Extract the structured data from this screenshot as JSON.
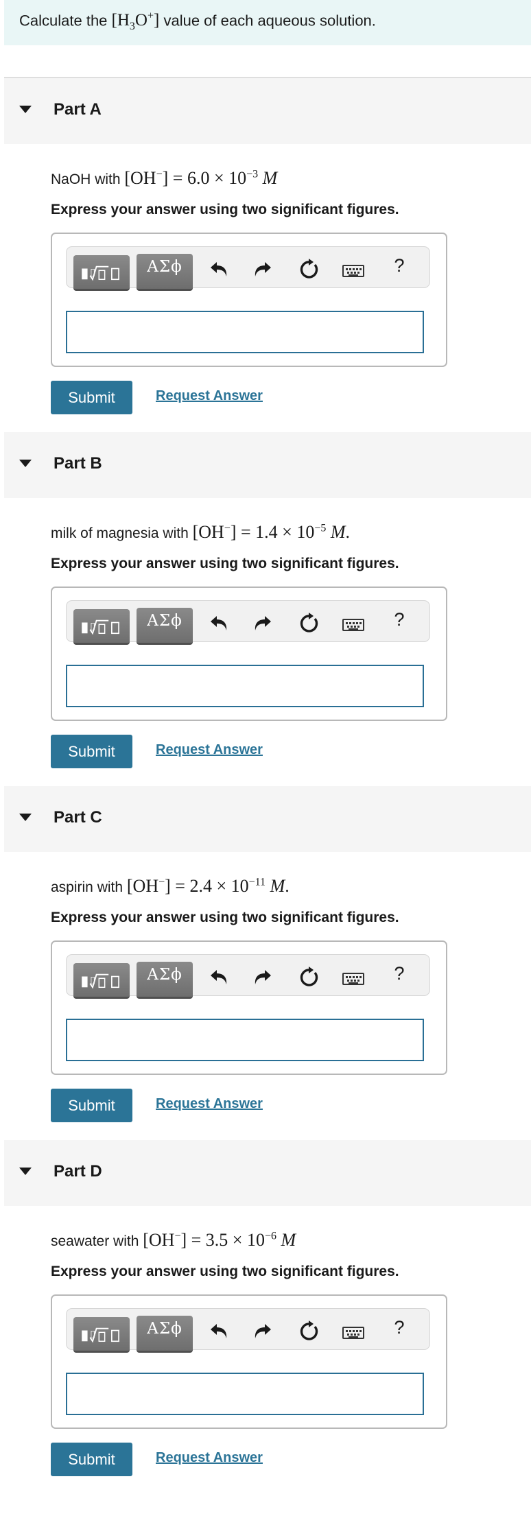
{
  "prompt": {
    "pre": "Calculate the ",
    "expr_open": "[H",
    "expr_sub": "3",
    "expr_mid": "O",
    "expr_sup": "+",
    "expr_close": "]",
    "post": " value of each aqueous solution."
  },
  "toolbar": {
    "templates_icon": "templates-radical-icon",
    "symbols_label": "ΑΣϕ",
    "undo_icon": "undo-icon",
    "redo_icon": "redo-icon",
    "reset_icon": "reset-icon",
    "keyboard_icon": "keyboard-icon",
    "help_label": "?"
  },
  "parts": [
    {
      "title": "Part A",
      "q_prefix": "NaOH",
      "q_with": " with ",
      "q_oh": "[OH",
      "q_minus": "−",
      "q_eq": "] = 6.0 × 10",
      "q_exp": "−3",
      "q_unit": "M",
      "q_end": "",
      "instruction": "Express your answer using two significant figures.",
      "answer_value": "",
      "submit_label": "Submit",
      "request_label": "Request Answer"
    },
    {
      "title": "Part B",
      "q_prefix": "milk of magnesia",
      "q_with": " with ",
      "q_oh": "[OH",
      "q_minus": "−",
      "q_eq": "] = 1.4 × 10",
      "q_exp": "−5",
      "q_unit": "M",
      "q_end": ".",
      "instruction": "Express your answer using two significant figures.",
      "answer_value": "",
      "submit_label": "Submit",
      "request_label": "Request Answer"
    },
    {
      "title": "Part C",
      "q_prefix": "aspirin",
      "q_with": " with ",
      "q_oh": "[OH",
      "q_minus": "−",
      "q_eq": "] = 2.4 × 10",
      "q_exp": "−11",
      "q_unit": "M",
      "q_end": ".",
      "instruction": "Express your answer using two significant figures.",
      "answer_value": "",
      "submit_label": "Submit",
      "request_label": "Request Answer"
    },
    {
      "title": "Part D",
      "q_prefix": "seawater",
      "q_with": " with ",
      "q_oh": "[OH",
      "q_minus": "−",
      "q_eq": "] = 3.5 × 10",
      "q_exp": "−6",
      "q_unit": "M",
      "q_end": "",
      "instruction": "Express your answer using two significant figures.",
      "answer_value": "",
      "submit_label": "Submit",
      "request_label": "Request Answer"
    }
  ],
  "colors": {
    "prompt_bg": "#e9f6f6",
    "part_header_bg": "#f5f5f5",
    "accent": "#2b7497",
    "input_border": "#2a6f95"
  }
}
